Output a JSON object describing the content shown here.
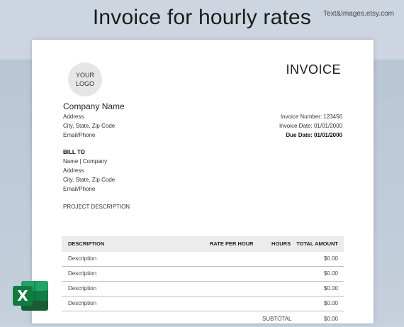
{
  "banner": {
    "headline": "Invoice for hourly rates",
    "shop": "Text&Images.etsy.com"
  },
  "logo": {
    "line1": "YOUR",
    "line2": "LOGO"
  },
  "invoice": {
    "title": "INVOICE",
    "number": "Invoice Number: 123456",
    "date": "Invoice Date: 01/01/2000",
    "due_date": "Due Date: 01/01/2000"
  },
  "sender": {
    "company": "Company Name",
    "address": "Address",
    "city": "City, State, Zip Code",
    "contact": "Email/Phone"
  },
  "bill_to": {
    "label": "BILL TO",
    "name": "Name | Company",
    "address": "Address",
    "city": "City, State, Zip Code",
    "contact": "Email/Phone"
  },
  "project": "PROJECT DESCRIPTION",
  "table": {
    "headers": {
      "description": "DESCRIPTION",
      "rate": "RATE PER HOUR",
      "hours": "HOURS",
      "total": "TOTAL AMOUNT"
    },
    "rows": [
      {
        "description": "Description",
        "total": "$0.00"
      },
      {
        "description": "Description",
        "total": "$0.00"
      },
      {
        "description": "Description",
        "total": "$0.00"
      },
      {
        "description": "Description",
        "total": "$0.00"
      }
    ],
    "subtotal_label": "SUBTOTAL",
    "subtotal_value": "$0.00"
  },
  "icons": {
    "excel": "excel-icon"
  },
  "colors": {
    "excel_green": "#21a366",
    "excel_dark": "#107c41",
    "banner": "#cdd6e0"
  }
}
